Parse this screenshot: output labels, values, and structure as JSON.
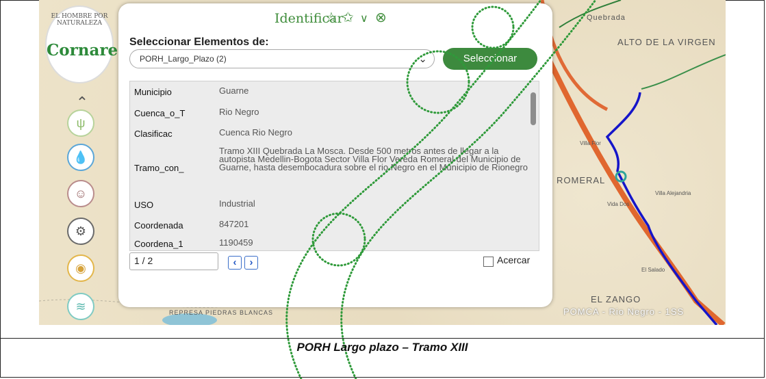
{
  "panel": {
    "title": "Identificar",
    "select_label": "Seleccionar Elementos de:",
    "select_value": "PORH_Largo_Plazo (2)",
    "select_button": "Seleccionar",
    "rows": [
      {
        "key": "Municipio",
        "value": "Guarne"
      },
      {
        "key": "Cuenca_o_T",
        "value": "Rio Negro"
      },
      {
        "key": "Clasificac",
        "value": "Cuenca Rio Negro"
      },
      {
        "key": "Tramo_con_",
        "value": "Tramo XIII Quebrada La Mosca. Desde 500 metros antes de llegar a la autopista Medellin-Bogota Sector Villa Flor Vereda Romeral del Municipio de Guarne, hasta desembocadura sobre el rio Negro en el Municipio de Rionegro"
      },
      {
        "key": "USO",
        "value": "Industrial"
      },
      {
        "key": "Coordenada",
        "value": "847201"
      },
      {
        "key": "Coordena_1",
        "value": "1190459"
      }
    ],
    "pager_value": "1 / 2",
    "zoom_checkbox_label": "Acercar"
  },
  "logo": {
    "arc_text": "EL HOMBRE POR NATURALEZA",
    "name": "Cornare"
  },
  "map_labels": {
    "alto": "ALTO DE LA VIRGEN",
    "romeral": "ROMERAL",
    "zango": "EL ZANGO",
    "pomca": "POMCA - Rio Negro - 1SS",
    "quebrada": "Quebrada",
    "represa": "REPRESA PIEDRAS BLANCAS",
    "villa_flor": "Villa Flor",
    "vida_dos": "Vida Dos",
    "villa_alejandria": "Villa Alejandria",
    "el_salado": "El Salado"
  },
  "caption": "PORH Largo plazo – Tramo XIII"
}
